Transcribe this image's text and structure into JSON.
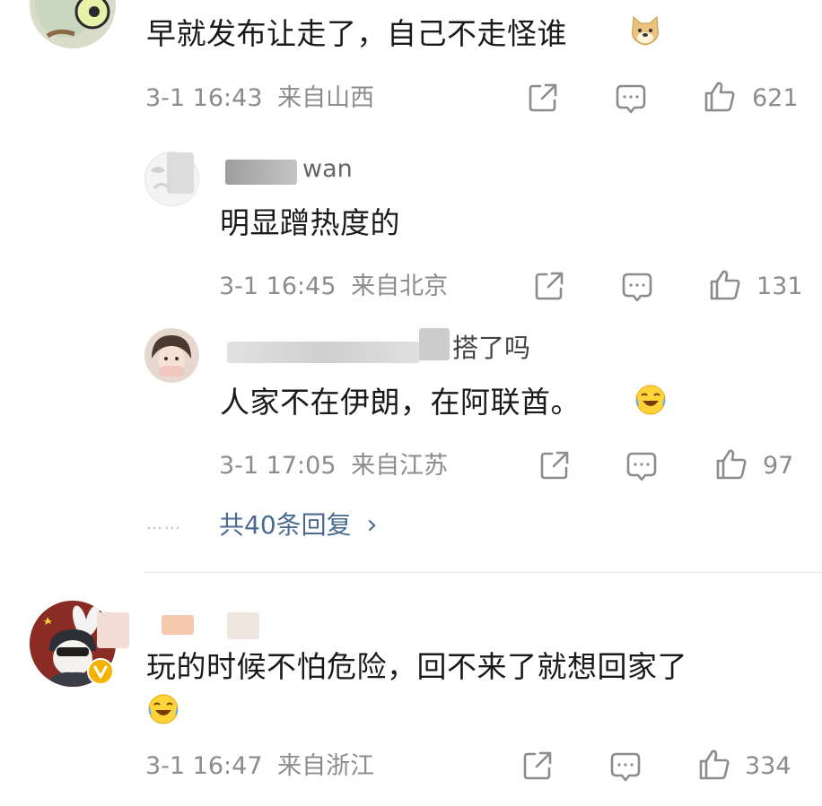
{
  "comments": [
    {
      "text": "早就发布让走了，自己不走怪谁",
      "time": "3-1 16:43",
      "location": "来自山西",
      "likes": "621",
      "emoji": "doge-emoji"
    },
    {
      "name_visible": "wan",
      "text": "明显蹭热度的",
      "time": "3-1 16:45",
      "location": "来自北京",
      "likes": "131"
    },
    {
      "name_visible": "搭了吗",
      "text": "人家不在伊朗，在阿联酋。",
      "time": "3-1 17:05",
      "location": "来自江苏",
      "likes": "97",
      "emoji": "laugh-cry-emoji"
    },
    {
      "text": "玩的时候不怕危险，回不来了就想回家了",
      "time": "3-1 16:47",
      "location": "来自浙江",
      "likes": "334",
      "emoji": "laugh-cry-emoji"
    }
  ],
  "more_replies": {
    "dots": "……",
    "label": "共40条回复",
    "chevron": "›"
  },
  "icons": {
    "share": "share-icon",
    "comment": "comment-icon",
    "like": "thumbs-up-icon",
    "verified": "verified-badge-icon"
  },
  "colors": {
    "text": "#1a1a1a",
    "meta": "#8c8c8c",
    "link": "#4a6b8f",
    "verified": "#f5b300"
  }
}
